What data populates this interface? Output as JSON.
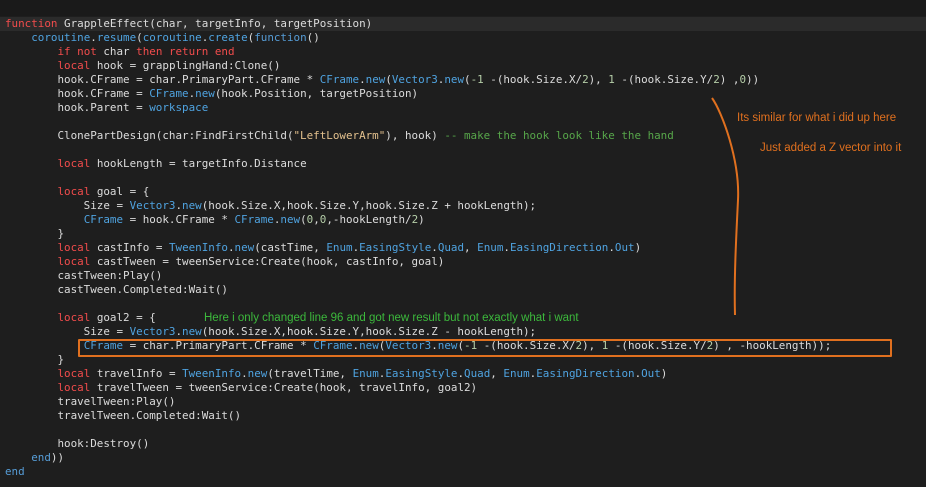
{
  "colors": {
    "background": "#1e1e1e",
    "keyword": "#f14c4c",
    "keyword2": "#569cd6",
    "reference": "#4fa3e0",
    "number": "#b5cea8",
    "string": "#e2c08d",
    "comment": "#57a64a",
    "annotation_orange": "#e0701f",
    "annotation_green": "#3cb93c"
  },
  "code_lines": [
    [
      [
        "kw",
        "function"
      ],
      [
        "plain",
        " GrappleEffect(char, targetInfo, targetPosition)"
      ]
    ],
    [
      [
        "plain",
        "    "
      ],
      [
        "ref",
        "coroutine"
      ],
      [
        "plain",
        "."
      ],
      [
        "ref",
        "resume"
      ],
      [
        "plain",
        "("
      ],
      [
        "ref",
        "coroutine"
      ],
      [
        "plain",
        "."
      ],
      [
        "ref",
        "create"
      ],
      [
        "plain",
        "("
      ],
      [
        "kw2",
        "function"
      ],
      [
        "plain",
        "()"
      ]
    ],
    [
      [
        "plain",
        "        "
      ],
      [
        "kw",
        "if not"
      ],
      [
        "plain",
        " char "
      ],
      [
        "kw",
        "then return end"
      ]
    ],
    [
      [
        "plain",
        "        "
      ],
      [
        "kw",
        "local"
      ],
      [
        "plain",
        " hook = grapplingHand:Clone()"
      ]
    ],
    [
      [
        "plain",
        "        hook.CFrame = char.PrimaryPart.CFrame * "
      ],
      [
        "ref",
        "CFrame"
      ],
      [
        "plain",
        "."
      ],
      [
        "ref",
        "new"
      ],
      [
        "plain",
        "("
      ],
      [
        "ref",
        "Vector3"
      ],
      [
        "plain",
        "."
      ],
      [
        "ref",
        "new"
      ],
      [
        "plain",
        "("
      ],
      [
        "num",
        "-1"
      ],
      [
        "plain",
        " -(hook.Size.X/"
      ],
      [
        "num",
        "2"
      ],
      [
        "plain",
        "), "
      ],
      [
        "num",
        "1"
      ],
      [
        "plain",
        " -(hook.Size.Y/"
      ],
      [
        "num",
        "2"
      ],
      [
        "plain",
        ") ,"
      ],
      [
        "num",
        "0"
      ],
      [
        "plain",
        "))"
      ]
    ],
    [
      [
        "plain",
        "        hook.CFrame = "
      ],
      [
        "ref",
        "CFrame"
      ],
      [
        "plain",
        "."
      ],
      [
        "ref",
        "new"
      ],
      [
        "plain",
        "(hook.Position, targetPosition)"
      ]
    ],
    [
      [
        "plain",
        "        hook.Parent = "
      ],
      [
        "ref",
        "workspace"
      ]
    ],
    [
      [
        "plain",
        ""
      ]
    ],
    [
      [
        "plain",
        "        ClonePartDesign(char:FindFirstChild("
      ],
      [
        "str",
        "\"LeftLowerArm\""
      ],
      [
        "plain",
        "), hook) "
      ],
      [
        "com",
        "-- make the hook look like the hand"
      ]
    ],
    [
      [
        "plain",
        ""
      ]
    ],
    [
      [
        "plain",
        "        "
      ],
      [
        "kw",
        "local"
      ],
      [
        "plain",
        " hookLength = targetInfo.Distance"
      ]
    ],
    [
      [
        "plain",
        ""
      ]
    ],
    [
      [
        "plain",
        "        "
      ],
      [
        "kw",
        "local"
      ],
      [
        "plain",
        " goal = {"
      ]
    ],
    [
      [
        "plain",
        "            Size = "
      ],
      [
        "ref",
        "Vector3"
      ],
      [
        "plain",
        "."
      ],
      [
        "ref",
        "new"
      ],
      [
        "plain",
        "(hook.Size.X,hook.Size.Y,hook.Size.Z + hookLength);"
      ]
    ],
    [
      [
        "plain",
        "            "
      ],
      [
        "ref",
        "CFrame"
      ],
      [
        "plain",
        " = hook.CFrame * "
      ],
      [
        "ref",
        "CFrame"
      ],
      [
        "plain",
        "."
      ],
      [
        "ref",
        "new"
      ],
      [
        "plain",
        "("
      ],
      [
        "num",
        "0"
      ],
      [
        "plain",
        ","
      ],
      [
        "num",
        "0"
      ],
      [
        "plain",
        ",-hookLength/"
      ],
      [
        "num",
        "2"
      ],
      [
        "plain",
        ")"
      ]
    ],
    [
      [
        "plain",
        "        }"
      ]
    ],
    [
      [
        "plain",
        "        "
      ],
      [
        "kw",
        "local"
      ],
      [
        "plain",
        " castInfo = "
      ],
      [
        "ref",
        "TweenInfo"
      ],
      [
        "plain",
        "."
      ],
      [
        "ref",
        "new"
      ],
      [
        "plain",
        "(castTime, "
      ],
      [
        "ref",
        "Enum"
      ],
      [
        "plain",
        "."
      ],
      [
        "ref",
        "EasingStyle"
      ],
      [
        "plain",
        "."
      ],
      [
        "ref",
        "Quad"
      ],
      [
        "plain",
        ", "
      ],
      [
        "ref",
        "Enum"
      ],
      [
        "plain",
        "."
      ],
      [
        "ref",
        "EasingDirection"
      ],
      [
        "plain",
        "."
      ],
      [
        "ref",
        "Out"
      ],
      [
        "plain",
        ")"
      ]
    ],
    [
      [
        "plain",
        "        "
      ],
      [
        "kw",
        "local"
      ],
      [
        "plain",
        " castTween = tweenService:Create(hook, castInfo, goal)"
      ]
    ],
    [
      [
        "plain",
        "        castTween:Play()"
      ]
    ],
    [
      [
        "plain",
        "        castTween.Completed:Wait()"
      ]
    ],
    [
      [
        "plain",
        ""
      ]
    ],
    [
      [
        "plain",
        "        "
      ],
      [
        "kw",
        "local"
      ],
      [
        "plain",
        " goal2 = {"
      ]
    ],
    [
      [
        "plain",
        "            Size = "
      ],
      [
        "ref",
        "Vector3"
      ],
      [
        "plain",
        "."
      ],
      [
        "ref",
        "new"
      ],
      [
        "plain",
        "(hook.Size.X,hook.Size.Y,hook.Size.Z - hookLength);"
      ]
    ],
    [
      [
        "plain",
        "            "
      ],
      [
        "ref",
        "CFrame"
      ],
      [
        "plain",
        " = char.PrimaryPart.CFrame * "
      ],
      [
        "ref",
        "CFrame"
      ],
      [
        "plain",
        "."
      ],
      [
        "ref",
        "new"
      ],
      [
        "plain",
        "("
      ],
      [
        "ref",
        "Vector3"
      ],
      [
        "plain",
        "."
      ],
      [
        "ref",
        "new"
      ],
      [
        "plain",
        "("
      ],
      [
        "num",
        "-1"
      ],
      [
        "plain",
        " -(hook.Size.X/"
      ],
      [
        "num",
        "2"
      ],
      [
        "plain",
        "), "
      ],
      [
        "num",
        "1"
      ],
      [
        "plain",
        " -(hook.Size.Y/"
      ],
      [
        "num",
        "2"
      ],
      [
        "plain",
        ") , -hookLength));"
      ]
    ],
    [
      [
        "plain",
        "        }"
      ]
    ],
    [
      [
        "plain",
        "        "
      ],
      [
        "kw",
        "local"
      ],
      [
        "plain",
        " travelInfo = "
      ],
      [
        "ref",
        "TweenInfo"
      ],
      [
        "plain",
        "."
      ],
      [
        "ref",
        "new"
      ],
      [
        "plain",
        "(travelTime, "
      ],
      [
        "ref",
        "Enum"
      ],
      [
        "plain",
        "."
      ],
      [
        "ref",
        "EasingStyle"
      ],
      [
        "plain",
        "."
      ],
      [
        "ref",
        "Quad"
      ],
      [
        "plain",
        ", "
      ],
      [
        "ref",
        "Enum"
      ],
      [
        "plain",
        "."
      ],
      [
        "ref",
        "EasingDirection"
      ],
      [
        "plain",
        "."
      ],
      [
        "ref",
        "Out"
      ],
      [
        "plain",
        ")"
      ]
    ],
    [
      [
        "plain",
        "        "
      ],
      [
        "kw",
        "local"
      ],
      [
        "plain",
        " travelTween = tweenService:Create(hook, travelInfo, goal2)"
      ]
    ],
    [
      [
        "plain",
        "        travelTween:Play()"
      ]
    ],
    [
      [
        "plain",
        "        travelTween.Completed:Wait()"
      ]
    ],
    [
      [
        "plain",
        ""
      ]
    ],
    [
      [
        "plain",
        "        hook:Destroy()"
      ]
    ],
    [
      [
        "plain",
        "    "
      ],
      [
        "kw2",
        "end"
      ],
      [
        "plain",
        "))"
      ]
    ],
    [
      [
        "kw2",
        "end"
      ]
    ]
  ],
  "annotations": {
    "note1": "Its similar for what i did up here",
    "note2": "Just added a Z vector into it",
    "note3": "Here i only changed line 96 and got new result but not exactly what i want"
  }
}
